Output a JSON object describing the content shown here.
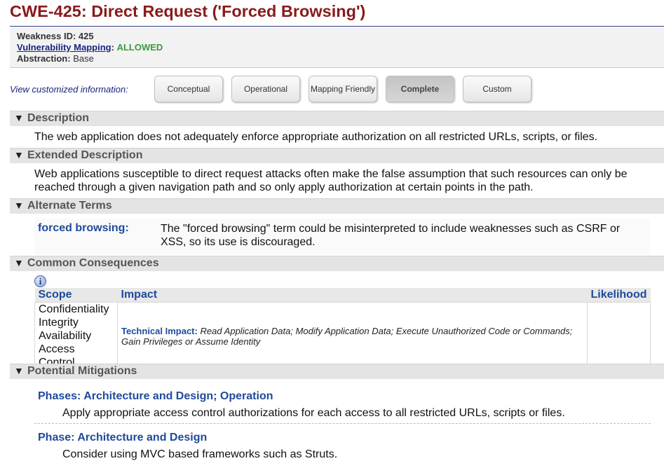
{
  "page": {
    "title": "CWE-425: Direct Request ('Forced Browsing')"
  },
  "info": {
    "weakness_id_label": "Weakness ID:",
    "weakness_id": "425",
    "mapping_label": "Vulnerability Mapping",
    "mapping_value": "ALLOWED",
    "abstraction_label": "Abstraction:",
    "abstraction_value": "Base"
  },
  "views": {
    "label": "View customized information:",
    "buttons": [
      "Conceptual",
      "Operational",
      "Mapping Friendly",
      "Complete",
      "Custom"
    ],
    "active": "Complete"
  },
  "sections": {
    "description": {
      "title": "Description",
      "text": "The web application does not adequately enforce appropriate authorization on all restricted URLs, scripts, or files."
    },
    "extended": {
      "title": "Extended Description",
      "text": "Web applications susceptible to direct request attacks often make the false assumption that such resources can only be reached through a given navigation path and so only apply authorization at certain points in the path."
    },
    "alternate": {
      "title": "Alternate Terms",
      "term": "forced browsing:",
      "desc": "The \"forced browsing\" term could be misinterpreted to include weaknesses such as CSRF or XSS, so its use is discouraged."
    },
    "consequences": {
      "title": "Common Consequences",
      "info_icon": "info-icon",
      "headers": {
        "scope": "Scope",
        "impact": "Impact",
        "likelihood": "Likelihood"
      },
      "rows": [
        {
          "scopes": [
            "Confidentiality",
            "Integrity",
            "Availability",
            "Access Control"
          ],
          "impact_label": "Technical Impact:",
          "impact": "Read Application Data; Modify Application Data; Execute Unauthorized Code or Commands; Gain Privileges or Assume Identity",
          "likelihood": ""
        }
      ]
    },
    "mitigations": {
      "title": "Potential Mitigations",
      "items": [
        {
          "phase": "Phases: Architecture and Design; Operation",
          "text": "Apply appropriate access control authorizations for each access to all restricted URLs, scripts or files."
        },
        {
          "phase": "Phase: Architecture and Design",
          "text": "Consider using MVC based frameworks such as Struts."
        }
      ]
    }
  },
  "colors": {
    "title": "#8a1a1a",
    "link": "#1a237e",
    "allowed": "#3c9a3c",
    "heading": "#1f4a9a"
  }
}
